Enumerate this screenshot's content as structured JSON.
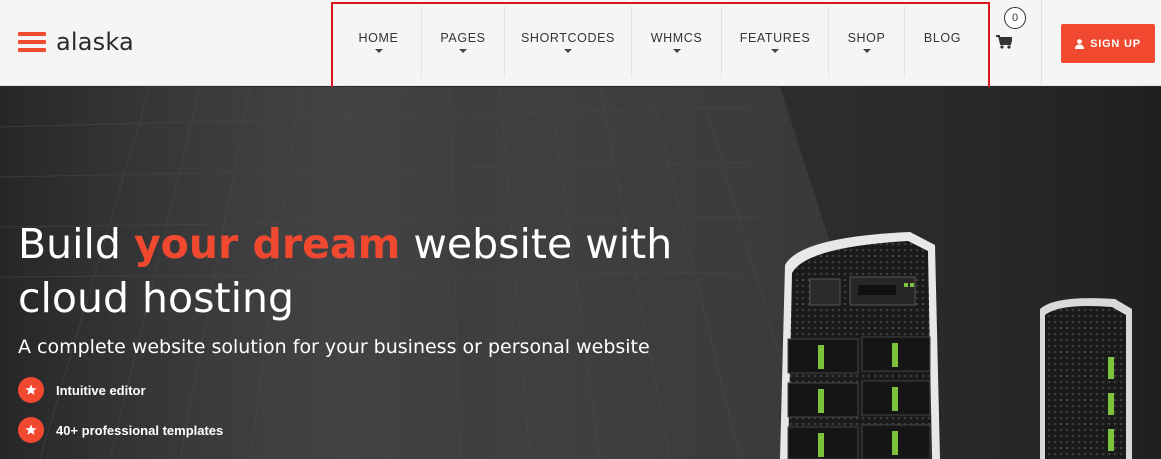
{
  "brand": {
    "name": "alaska"
  },
  "nav": {
    "items": [
      {
        "label": "HOME",
        "has_dropdown": true
      },
      {
        "label": "PAGES",
        "has_dropdown": true
      },
      {
        "label": "SHORTCODES",
        "has_dropdown": true
      },
      {
        "label": "WHMCS",
        "has_dropdown": true
      },
      {
        "label": "FEATURES",
        "has_dropdown": true
      },
      {
        "label": "SHOP",
        "has_dropdown": true
      },
      {
        "label": "BLOG",
        "has_dropdown": false
      }
    ]
  },
  "cart": {
    "count": "0",
    "icon": "shopping-cart-icon"
  },
  "signup": {
    "label": "SIGN UP",
    "icon": "user-icon"
  },
  "hero": {
    "title_pre": "Build ",
    "title_accent": "your dream",
    "title_post": " website with cloud hosting",
    "subtitle": "A complete website solution for your business or personal website",
    "features": [
      {
        "label": "Intuitive editor",
        "icon": "star-icon"
      },
      {
        "label": "40+ professional templates",
        "icon": "star-icon"
      }
    ]
  },
  "colors": {
    "accent": "#f0492f",
    "highlight_box": "#d9161c",
    "header_bg": "#f5f5f5",
    "hero_bg": "#2b2b2d"
  }
}
